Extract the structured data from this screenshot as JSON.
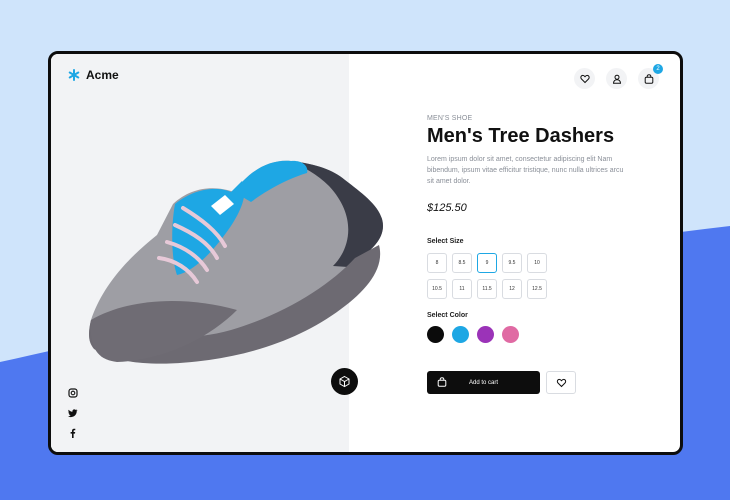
{
  "brand": {
    "name": "Acme",
    "icon": "asterisk-icon"
  },
  "header": {
    "icons": [
      "heart-icon",
      "user-icon",
      "bag-icon"
    ],
    "cart_count": "2"
  },
  "product": {
    "category": "MEN'S SHOE",
    "title": "Men's Tree Dashers",
    "description": "Lorem ipsum dolor sit amet, consectetur adipiscing elit Nam bibendum, ipsum vitae efficitur tristique, nunc nulla ultrices arcu sit amet dolor.",
    "price": "$125.50"
  },
  "sizes": {
    "label": "Select Size",
    "options": [
      "8",
      "8.5",
      "9",
      "9.5",
      "10",
      "10.5",
      "11",
      "11.5",
      "12",
      "12.5"
    ],
    "selected": "9"
  },
  "colors": {
    "label": "Select Color",
    "options": [
      "#0b0b0b",
      "#1ea7e4",
      "#9b33b8",
      "#e06aa3"
    ]
  },
  "actions": {
    "add_to_cart": "Add to cart"
  },
  "social": [
    "instagram-icon",
    "twitter-icon",
    "facebook-icon"
  ],
  "theme": {
    "accent": "#1ea7e4",
    "dark": "#0d0d0d",
    "backdrop_light": "#cfe4fb",
    "backdrop_blue": "#4f78f0"
  }
}
